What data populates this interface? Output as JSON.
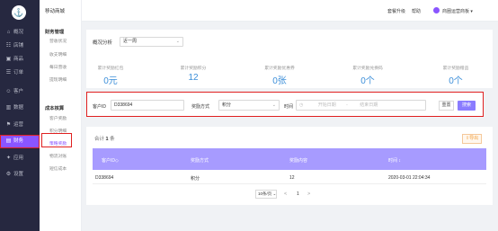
{
  "nav": {
    "logo": "⚓",
    "items": [
      {
        "icon": "⌂",
        "label": "概况"
      },
      {
        "icon": "☷",
        "label": "店铺"
      },
      {
        "icon": "▣",
        "label": "商品"
      },
      {
        "icon": "☰",
        "label": "订单"
      },
      {
        "icon": "☺",
        "label": "客户"
      },
      {
        "icon": "▥",
        "label": "数据"
      },
      {
        "icon": "⚑",
        "label": "运营"
      },
      {
        "icon": "▤",
        "label": "财务"
      },
      {
        "icon": "✦",
        "label": "应用"
      },
      {
        "icon": "⚙",
        "label": "设置"
      }
    ],
    "active_index": 7
  },
  "sub": {
    "title": "移动商城",
    "group1": "财务管理",
    "group1_items": [
      "营收状况",
      "收支明细",
      "每日营收",
      "提现明细"
    ],
    "group2": "成本核算",
    "group2_items": [
      "客户奖励",
      "积分明细",
      "策略奖励",
      "物流对账",
      "短信成本"
    ],
    "active_item": "策略奖励"
  },
  "topbar": {
    "upgrade": "套餐升级",
    "help": "帮助",
    "user": "商圈运营商板"
  },
  "overview": {
    "label": "概况分析",
    "range": "近一周",
    "stats": [
      {
        "label": "累计奖励红包",
        "value": "0元"
      },
      {
        "label": "累计奖励积分",
        "value": "12"
      },
      {
        "label": "累计奖励优惠券",
        "value": "0张"
      },
      {
        "label": "累计奖励兑换码",
        "value": "0个"
      },
      {
        "label": "累计奖励赠品",
        "value": "0个"
      }
    ]
  },
  "filter": {
    "customer_id_label": "客户ID",
    "customer_id_value": "D338694",
    "reward_method_label": "奖励方式",
    "reward_method_value": "积分",
    "time_label": "时间",
    "start_placeholder": "开始日期",
    "separator": "-",
    "end_placeholder": "结束日期",
    "reset": "重置",
    "search": "搜索"
  },
  "table": {
    "total_prefix": "合计",
    "total_count": "1",
    "total_suffix": "条",
    "export": "导出",
    "columns": [
      "客户ID◇",
      "奖励方式",
      "奖励内容",
      "时间 ↕"
    ],
    "rows": [
      [
        "D338694",
        "积分",
        "12",
        "2020-03-01 22:04:34"
      ]
    ],
    "page_size": "10条/页",
    "prev": "<",
    "page": "1",
    "next": ">"
  }
}
